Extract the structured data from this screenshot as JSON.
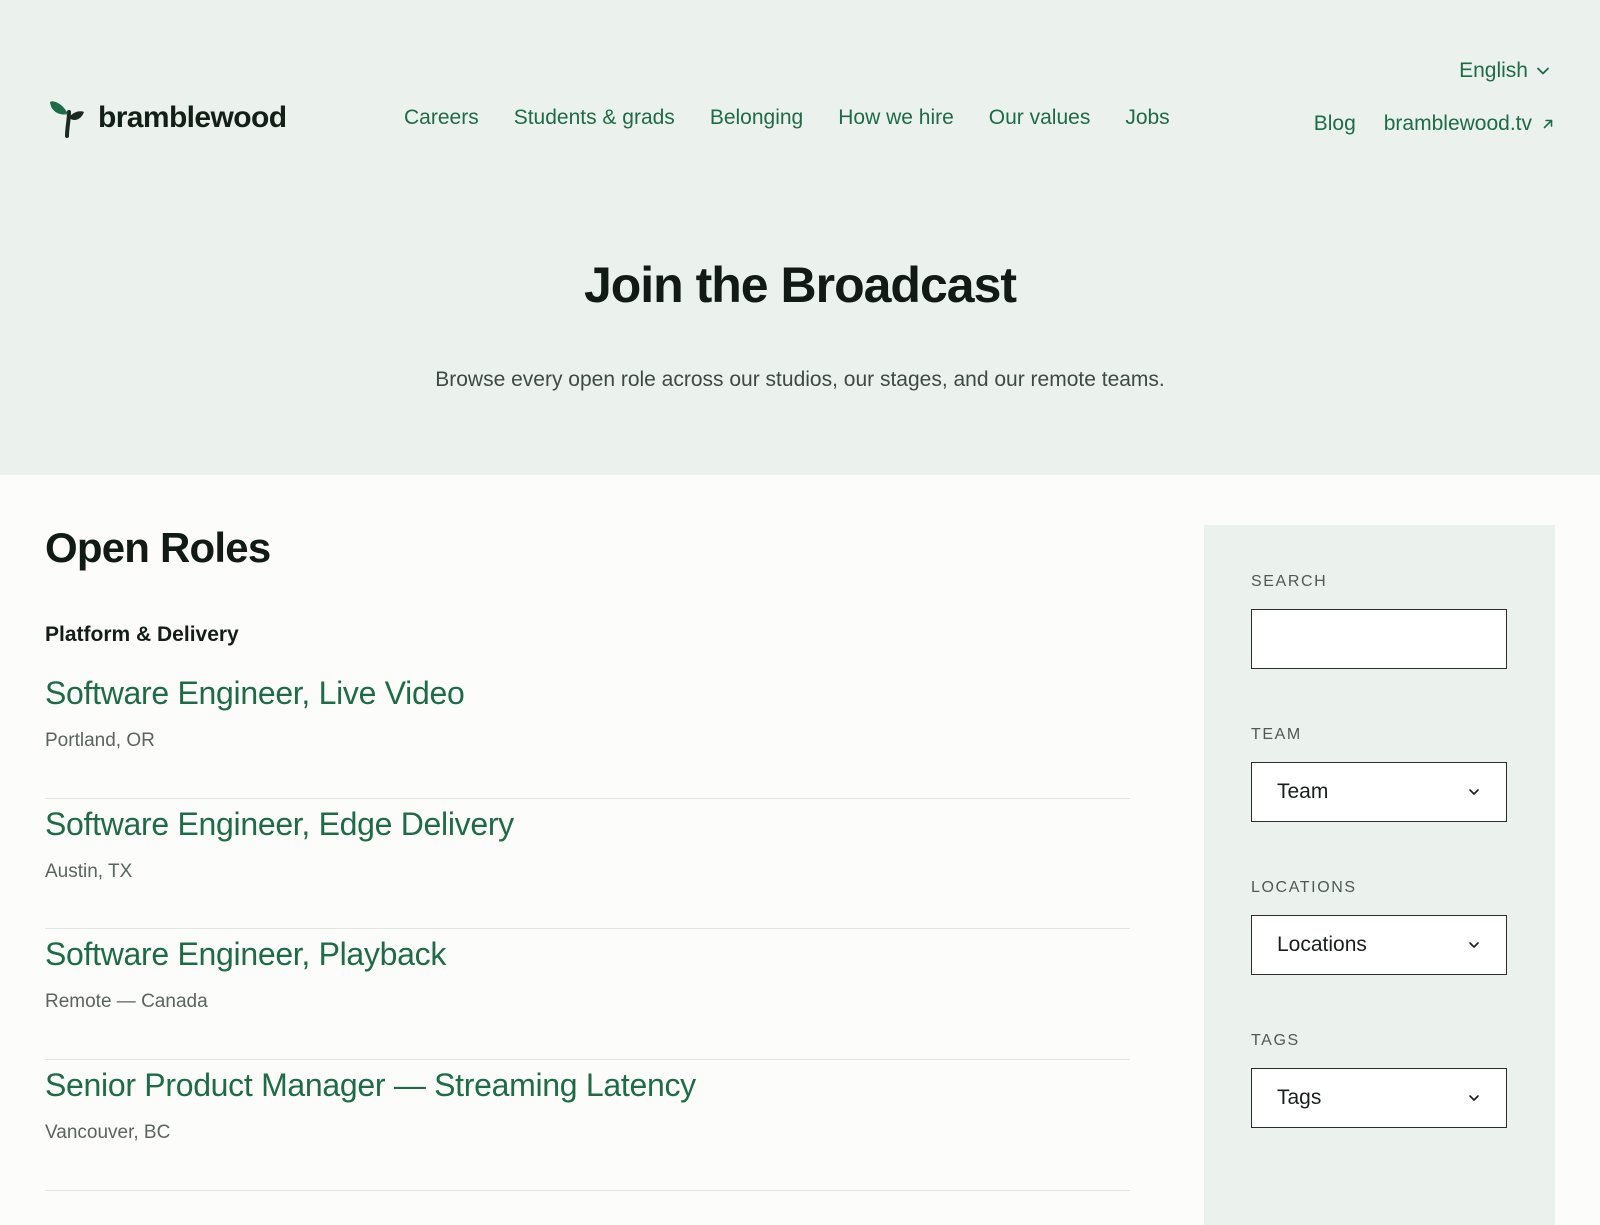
{
  "brand": {
    "name": "bramblewood",
    "color": "#1f6b47"
  },
  "nav": {
    "items": [
      "Careers",
      "Students & grads",
      "Belonging",
      "How we hire",
      "Our values",
      "Jobs"
    ]
  },
  "utility": {
    "language": "English",
    "blog": "Blog",
    "external_site": "bramblewood.tv"
  },
  "hero": {
    "title": "Join the Broadcast",
    "subtitle": "Browse every open role across our studios, our stages, and our remote teams."
  },
  "listing": {
    "heading": "Open Roles",
    "team": "Platform & Delivery",
    "roles": [
      {
        "title": "Software Engineer, Live Video",
        "location": "Portland, OR"
      },
      {
        "title": "Software Engineer, Edge Delivery",
        "location": "Austin, TX"
      },
      {
        "title": "Software Engineer, Playback",
        "location": "Remote — Canada"
      },
      {
        "title": "Senior Product Manager — Streaming Latency",
        "location": "Vancouver, BC"
      }
    ]
  },
  "filters": {
    "search": {
      "label": "SEARCH",
      "value": ""
    },
    "team": {
      "label": "TEAM",
      "selected": "Team"
    },
    "locations": {
      "label": "LOCATIONS",
      "selected": "Locations"
    },
    "tags": {
      "label": "TAGS",
      "selected": "Tags"
    }
  },
  "colors": {
    "accent": "#1f6b47",
    "hero_bg": "#ebf1ec",
    "page_bg": "#fcfdfa"
  }
}
